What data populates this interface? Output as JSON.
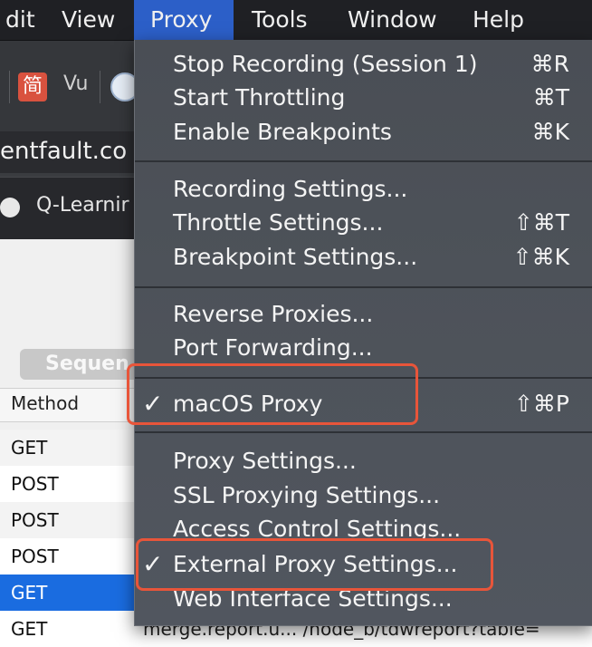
{
  "menubar": {
    "items": [
      {
        "label": "dit"
      },
      {
        "label": "View"
      },
      {
        "label": "Proxy"
      },
      {
        "label": "Tools"
      },
      {
        "label": "Window"
      },
      {
        "label": "Help"
      }
    ]
  },
  "browser": {
    "bookmark_icon_label": "简",
    "bookmark_text": "Vu",
    "url": "entfault.co",
    "tab_title": "Q-Learnir"
  },
  "app": {
    "segment_label": "Sequen",
    "column_method": "Method",
    "rows": [
      {
        "method": "GET"
      },
      {
        "method": "POST"
      },
      {
        "method": "POST"
      },
      {
        "method": "POST"
      },
      {
        "method": "GET"
      },
      {
        "method": "GET",
        "extra": "merge.report.u...  /node_b/tdwreport?table="
      }
    ]
  },
  "proxy_menu": {
    "items": [
      {
        "label": "Stop Recording (Session 1)",
        "shortcut": "⌘R"
      },
      {
        "label": "Start Throttling",
        "shortcut": "⌘T"
      },
      {
        "label": "Enable Breakpoints",
        "shortcut": "⌘K"
      },
      {
        "label": "Recording Settings...",
        "shortcut": ""
      },
      {
        "label": "Throttle Settings...",
        "shortcut": "⇧⌘T"
      },
      {
        "label": "Breakpoint Settings...",
        "shortcut": "⇧⌘K"
      },
      {
        "label": "Reverse Proxies...",
        "shortcut": ""
      },
      {
        "label": "Port Forwarding...",
        "shortcut": ""
      },
      {
        "label": "macOS Proxy",
        "shortcut": "⇧⌘P",
        "checked": true
      },
      {
        "label": "Proxy Settings...",
        "shortcut": ""
      },
      {
        "label": "SSL Proxying Settings...",
        "shortcut": ""
      },
      {
        "label": "Access Control Settings...",
        "shortcut": ""
      },
      {
        "label": "External Proxy Settings...",
        "shortcut": "",
        "checked": true
      },
      {
        "label": "Web Interface Settings...",
        "shortcut": ""
      }
    ],
    "check_glyph": "✓"
  },
  "colors": {
    "highlight": "#e8553a",
    "selection": "#1a6ce0",
    "active_menu": "#2c5fc8"
  }
}
